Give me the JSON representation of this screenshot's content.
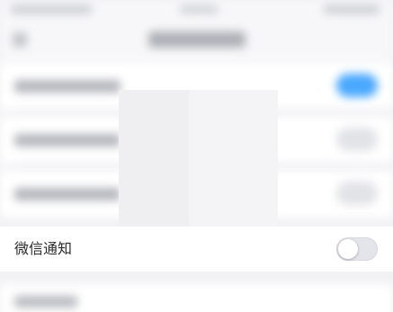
{
  "wechat_notification": {
    "label": "微信通知",
    "enabled": false
  },
  "colors": {
    "toggle_on": "#4aa8ff",
    "toggle_off": "#e4e5ea",
    "background": "#f2f2f5"
  },
  "icons": {
    "back": "chevron-left-icon"
  }
}
